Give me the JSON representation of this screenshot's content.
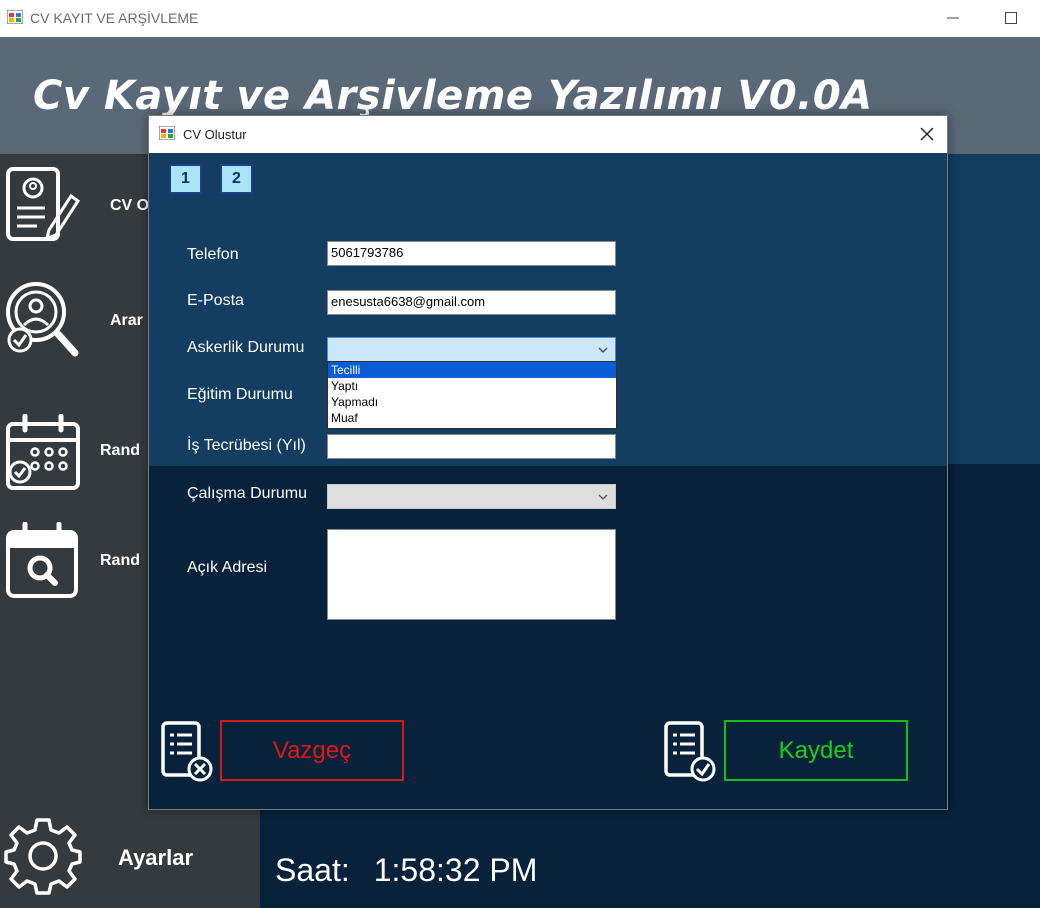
{
  "window": {
    "title": "CV KAYIT VE ARŞİVLEME",
    "controls": [
      "minimize-icon",
      "maximize-icon"
    ]
  },
  "header": {
    "title": "Cv Kayıt ve Arşivleme Yazılımı V0.0A"
  },
  "sidebar": {
    "items": [
      {
        "label": "CV O",
        "icon": "cv-form-icon"
      },
      {
        "label": "Arar",
        "icon": "search-person-icon"
      },
      {
        "label": "Rand",
        "icon": "calendar-check-icon"
      },
      {
        "label": "Rand",
        "icon": "calendar-search-icon"
      }
    ],
    "settings_label": "Ayarlar",
    "settings_icon": "gear-icon"
  },
  "status": {
    "clock_label": "Saat:",
    "clock_value": "1:58:32 PM"
  },
  "dialog": {
    "title": "CV Olustur",
    "tabs": [
      "1",
      "2"
    ],
    "fields": {
      "phone_label": "Telefon",
      "phone_value": "5061793786",
      "email_label": "E-Posta",
      "email_value": "enesusta6638@gmail.com",
      "military_label": "Askerlik Durumu",
      "military_value": "",
      "military_options": [
        "Tecilli",
        "Yaptı",
        "Yapmadı",
        "Muaf"
      ],
      "military_highlighted": "Tecilli",
      "education_label": "Eğitim Durumu",
      "experience_label": "İş Tecrübesi (Yıl)",
      "experience_value": "",
      "work_status_label": "Çalışma Durumu",
      "work_status_value": "",
      "address_label": "Açık Adresi",
      "address_value": ""
    },
    "buttons": {
      "cancel_label": "Vazgeç",
      "save_label": "Kaydet"
    }
  },
  "colors": {
    "header_bg": "#5a6978",
    "sidebar_bg": "#353a3f",
    "content_top_bg": "#143d62",
    "content_bottom_bg": "#07223a",
    "cancel": "#e01717",
    "save": "#14d21a",
    "tab_bg": "#a9e4f7",
    "selection": "#0a5bd6"
  }
}
